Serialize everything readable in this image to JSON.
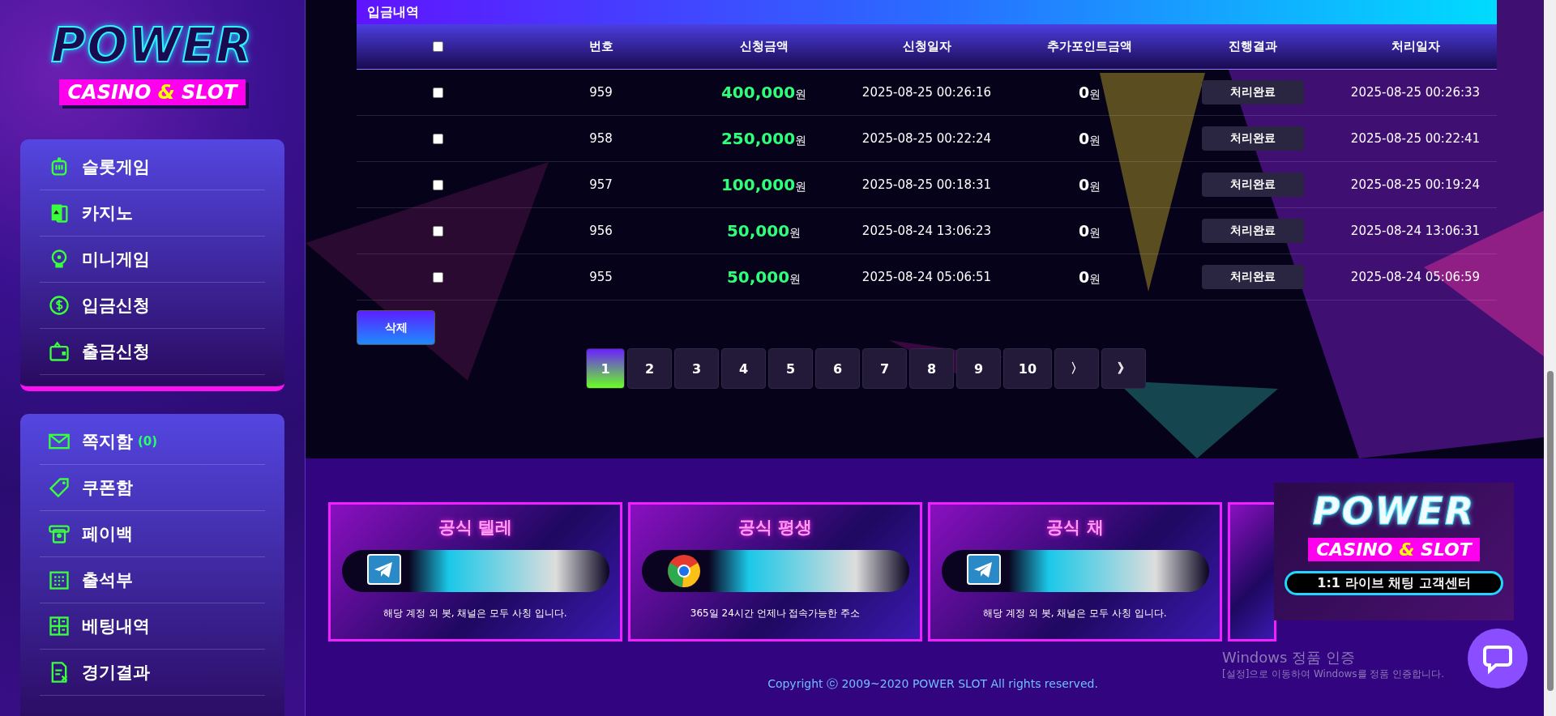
{
  "logo": {
    "title": "POWER",
    "sub_before": "CASINO",
    "sub_accent": "&",
    "sub_after": "SLOT"
  },
  "sidebar": {
    "games": [
      {
        "label": "슬롯게임"
      },
      {
        "label": "카지노"
      },
      {
        "label": "미니게임"
      },
      {
        "label": "입금신청"
      },
      {
        "label": "출금신청"
      }
    ],
    "account": [
      {
        "label": "쪽지함",
        "count": "(0)"
      },
      {
        "label": "쿠폰함"
      },
      {
        "label": "페이백"
      },
      {
        "label": "출석부"
      },
      {
        "label": "베팅내역"
      },
      {
        "label": "경기결과"
      }
    ]
  },
  "section_title": "입금내역",
  "table": {
    "header_checkbox": {
      "checked": false
    },
    "columns": [
      "번호",
      "신청금액",
      "신청일자",
      "추가포인트금액",
      "진행결과",
      "처리일자"
    ],
    "rows": [
      {
        "checked": false,
        "no": "959",
        "amount": "400,000",
        "amount_unit": "원",
        "requested": "2025-08-25 00:26:16",
        "points": "0",
        "points_unit": "원",
        "status": "처리완료",
        "processed": "2025-08-25 00:26:33"
      },
      {
        "checked": false,
        "no": "958",
        "amount": "250,000",
        "amount_unit": "원",
        "requested": "2025-08-25 00:22:24",
        "points": "0",
        "points_unit": "원",
        "status": "처리완료",
        "processed": "2025-08-25 00:22:41"
      },
      {
        "checked": false,
        "no": "957",
        "amount": "100,000",
        "amount_unit": "원",
        "requested": "2025-08-25 00:18:31",
        "points": "0",
        "points_unit": "원",
        "status": "처리완료",
        "processed": "2025-08-25 00:19:24"
      },
      {
        "checked": false,
        "no": "956",
        "amount": "50,000",
        "amount_unit": "원",
        "requested": "2025-08-24 13:06:23",
        "points": "0",
        "points_unit": "원",
        "status": "처리완료",
        "processed": "2025-08-24 13:06:31"
      },
      {
        "checked": false,
        "no": "955",
        "amount": "50,000",
        "amount_unit": "원",
        "requested": "2025-08-24 05:06:51",
        "points": "0",
        "points_unit": "원",
        "status": "처리완료",
        "processed": "2025-08-24 05:06:59"
      }
    ]
  },
  "delete_button": "삭제",
  "pagination": {
    "pages": [
      {
        "label": "1",
        "selected": true
      },
      {
        "label": "2",
        "selected": false
      },
      {
        "label": "3",
        "selected": false
      },
      {
        "label": "4",
        "selected": false
      },
      {
        "label": "5",
        "selected": false
      },
      {
        "label": "6",
        "selected": false
      },
      {
        "label": "7",
        "selected": false
      },
      {
        "label": "8",
        "selected": false
      },
      {
        "label": "9",
        "selected": false
      },
      {
        "label": "10",
        "selected": false
      }
    ],
    "next": "〉",
    "last": "》"
  },
  "banners": [
    {
      "kind": "telegram",
      "title": "공식 텔레",
      "caption": "해당 계정 외 봇, 채널은 모두 사칭 입니다."
    },
    {
      "kind": "browser",
      "title": "공식 평생",
      "caption": "365일 24시간 언제나 접속가능한 주소"
    },
    {
      "kind": "telegram",
      "title": "공식 채",
      "caption": "해당 계정 외 봇, 채널은 모두 사칭 입니다."
    }
  ],
  "popup": {
    "title": "POWER",
    "sub_before": "CASINO",
    "sub_accent": "&",
    "sub_after": "SLOT",
    "button": "1:1 라이브 채팅 고객센터"
  },
  "copyright": "Copyright ⓒ 2009~2020 POWER SLOT All rights reserved.",
  "os_notice": {
    "title": "Windows 정품 인증",
    "text": "[설정]으로 이동하여 Windows를 정품 인증합니다."
  }
}
